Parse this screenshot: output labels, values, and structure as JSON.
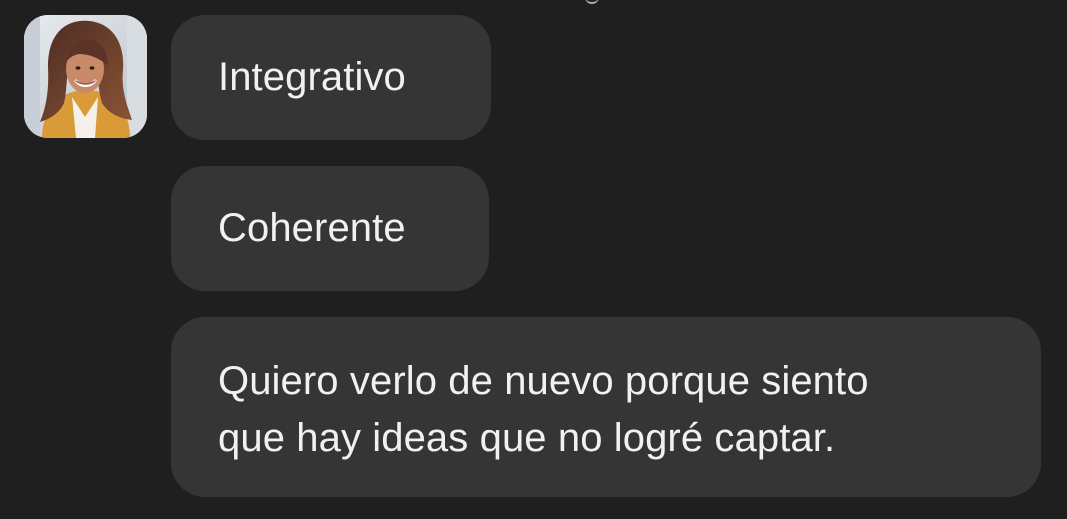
{
  "chat": {
    "messages": [
      {
        "text": "Integrativo"
      },
      {
        "text": "Coherente"
      },
      {
        "text": "Quiero verlo de nuevo porque siento\nque hay ideas que no logré captar."
      }
    ]
  },
  "colors": {
    "background": "#1f1f1f",
    "bubble": "#353535",
    "text": "#f1f1f1",
    "avatar_jacket": "#e3a43b",
    "avatar_hair": "#6a3f2f"
  },
  "avatar": {
    "icon": "user-avatar-photo"
  }
}
